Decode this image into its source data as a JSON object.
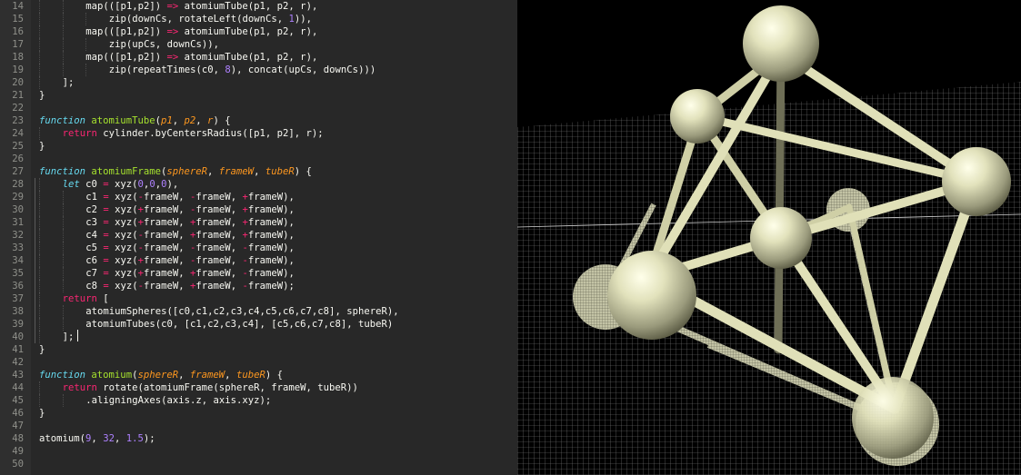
{
  "editor": {
    "lines": [
      {
        "n": "14",
        "ind": 2,
        "t": [
          [
            "map(([p1,p2]) ",
            ""
          ],
          [
            "=>",
            "op"
          ],
          [
            " atomiumTube(p1, p2, r),",
            ""
          ]
        ]
      },
      {
        "n": "15",
        "ind": 3,
        "t": [
          [
            "zip(downCs, rotateLeft(downCs, ",
            ""
          ],
          [
            "1",
            "num"
          ],
          [
            ")),",
            ""
          ]
        ]
      },
      {
        "n": "16",
        "ind": 2,
        "t": [
          [
            "map(([p1,p2]) ",
            ""
          ],
          [
            "=>",
            "op"
          ],
          [
            " atomiumTube(p1, p2, r),",
            ""
          ]
        ]
      },
      {
        "n": "17",
        "ind": 3,
        "t": [
          [
            "zip(upCs, downCs)),",
            ""
          ]
        ]
      },
      {
        "n": "18",
        "ind": 2,
        "t": [
          [
            "map(([p1,p2]) ",
            ""
          ],
          [
            "=>",
            "op"
          ],
          [
            " atomiumTube(p1, p2, r),",
            ""
          ]
        ]
      },
      {
        "n": "19",
        "ind": 3,
        "t": [
          [
            "zip(repeatTimes(c0, ",
            ""
          ],
          [
            "8",
            "num"
          ],
          [
            "), concat(upCs, downCs)))",
            ""
          ]
        ]
      },
      {
        "n": "20",
        "ind": 1,
        "t": [
          [
            "];",
            ""
          ]
        ]
      },
      {
        "n": "21",
        "ind": 0,
        "t": [
          [
            "}",
            ""
          ]
        ]
      },
      {
        "n": "22",
        "ind": 0,
        "t": []
      },
      {
        "n": "23",
        "ind": 0,
        "t": [
          [
            "function",
            "kw"
          ],
          [
            " ",
            ""
          ],
          [
            "atomiumTube",
            "fn"
          ],
          [
            "(",
            ""
          ],
          [
            "p1",
            "prm"
          ],
          [
            ", ",
            ""
          ],
          [
            "p2",
            "prm"
          ],
          [
            ", ",
            ""
          ],
          [
            "r",
            "prm"
          ],
          [
            ") {",
            ""
          ]
        ]
      },
      {
        "n": "24",
        "ind": 1,
        "t": [
          [
            "return",
            "kw2"
          ],
          [
            " cylinder.byCentersRadius([p1, p2], r);",
            ""
          ]
        ]
      },
      {
        "n": "25",
        "ind": 0,
        "t": [
          [
            "}",
            ""
          ]
        ]
      },
      {
        "n": "26",
        "ind": 0,
        "t": []
      },
      {
        "n": "27",
        "ind": 0,
        "t": [
          [
            "function",
            "kw"
          ],
          [
            " ",
            ""
          ],
          [
            "atomiumFrame",
            "fn"
          ],
          [
            "(",
            ""
          ],
          [
            "sphereR",
            "prm"
          ],
          [
            ", ",
            ""
          ],
          [
            "frameW",
            "prm"
          ],
          [
            ", ",
            ""
          ],
          [
            "tubeR",
            "prm"
          ],
          [
            ") {",
            ""
          ]
        ]
      },
      {
        "n": "28",
        "ind": 1,
        "t": [
          [
            "let",
            "kw"
          ],
          [
            " c0 ",
            ""
          ],
          [
            "=",
            "op"
          ],
          [
            " xyz(",
            ""
          ],
          [
            "0",
            "num"
          ],
          [
            ",",
            ""
          ],
          [
            "0",
            "num"
          ],
          [
            ",",
            ""
          ],
          [
            "0",
            "num"
          ],
          [
            "),",
            ""
          ]
        ]
      },
      {
        "n": "29",
        "ind": 2,
        "t": [
          [
            "c1 ",
            ""
          ],
          [
            "=",
            "op"
          ],
          [
            " xyz(",
            ""
          ],
          [
            "-",
            "op"
          ],
          [
            "frameW, ",
            ""
          ],
          [
            "-",
            "op"
          ],
          [
            "frameW, ",
            ""
          ],
          [
            "+",
            "op"
          ],
          [
            "frameW),",
            ""
          ]
        ]
      },
      {
        "n": "30",
        "ind": 2,
        "t": [
          [
            "c2 ",
            ""
          ],
          [
            "=",
            "op"
          ],
          [
            " xyz(",
            ""
          ],
          [
            "+",
            "op"
          ],
          [
            "frameW, ",
            ""
          ],
          [
            "-",
            "op"
          ],
          [
            "frameW, ",
            ""
          ],
          [
            "+",
            "op"
          ],
          [
            "frameW),",
            ""
          ]
        ]
      },
      {
        "n": "31",
        "ind": 2,
        "t": [
          [
            "c3 ",
            ""
          ],
          [
            "=",
            "op"
          ],
          [
            " xyz(",
            ""
          ],
          [
            "+",
            "op"
          ],
          [
            "frameW, ",
            ""
          ],
          [
            "+",
            "op"
          ],
          [
            "frameW, ",
            ""
          ],
          [
            "+",
            "op"
          ],
          [
            "frameW),",
            ""
          ]
        ]
      },
      {
        "n": "32",
        "ind": 2,
        "t": [
          [
            "c4 ",
            ""
          ],
          [
            "=",
            "op"
          ],
          [
            " xyz(",
            ""
          ],
          [
            "-",
            "op"
          ],
          [
            "frameW, ",
            ""
          ],
          [
            "+",
            "op"
          ],
          [
            "frameW, ",
            ""
          ],
          [
            "+",
            "op"
          ],
          [
            "frameW),",
            ""
          ]
        ]
      },
      {
        "n": "33",
        "ind": 2,
        "t": [
          [
            "c5 ",
            ""
          ],
          [
            "=",
            "op"
          ],
          [
            " xyz(",
            ""
          ],
          [
            "-",
            "op"
          ],
          [
            "frameW, ",
            ""
          ],
          [
            "-",
            "op"
          ],
          [
            "frameW, ",
            ""
          ],
          [
            "-",
            "op"
          ],
          [
            "frameW),",
            ""
          ]
        ]
      },
      {
        "n": "34",
        "ind": 2,
        "t": [
          [
            "c6 ",
            ""
          ],
          [
            "=",
            "op"
          ],
          [
            " xyz(",
            ""
          ],
          [
            "+",
            "op"
          ],
          [
            "frameW, ",
            ""
          ],
          [
            "-",
            "op"
          ],
          [
            "frameW, ",
            ""
          ],
          [
            "-",
            "op"
          ],
          [
            "frameW),",
            ""
          ]
        ]
      },
      {
        "n": "35",
        "ind": 2,
        "t": [
          [
            "c7 ",
            ""
          ],
          [
            "=",
            "op"
          ],
          [
            " xyz(",
            ""
          ],
          [
            "+",
            "op"
          ],
          [
            "frameW, ",
            ""
          ],
          [
            "+",
            "op"
          ],
          [
            "frameW, ",
            ""
          ],
          [
            "-",
            "op"
          ],
          [
            "frameW),",
            ""
          ]
        ]
      },
      {
        "n": "36",
        "ind": 2,
        "t": [
          [
            "c8 ",
            ""
          ],
          [
            "=",
            "op"
          ],
          [
            " xyz(",
            ""
          ],
          [
            "-",
            "op"
          ],
          [
            "frameW, ",
            ""
          ],
          [
            "+",
            "op"
          ],
          [
            "frameW, ",
            ""
          ],
          [
            "-",
            "op"
          ],
          [
            "frameW);",
            ""
          ]
        ]
      },
      {
        "n": "37",
        "ind": 1,
        "t": [
          [
            "return",
            "kw2"
          ],
          [
            " [",
            ""
          ]
        ]
      },
      {
        "n": "38",
        "ind": 2,
        "t": [
          [
            "atomiumSpheres([c0,c1,c2,c3,c4,c5,c6,c7,c8], sphereR),",
            ""
          ]
        ]
      },
      {
        "n": "39",
        "ind": 2,
        "t": [
          [
            "atomiumTubes(c0, [c1,c2,c3,c4], [c5,c6,c7,c8], tubeR)",
            ""
          ]
        ]
      },
      {
        "n": "40",
        "ind": 1,
        "t": [
          [
            "];",
            ""
          ]
        ]
      },
      {
        "n": "41",
        "ind": 0,
        "t": [
          [
            "}",
            ""
          ]
        ]
      },
      {
        "n": "42",
        "ind": 0,
        "t": []
      },
      {
        "n": "43",
        "ind": 0,
        "t": [
          [
            "function",
            "kw"
          ],
          [
            " ",
            ""
          ],
          [
            "atomium",
            "fn"
          ],
          [
            "(",
            ""
          ],
          [
            "sphereR",
            "prm"
          ],
          [
            ", ",
            ""
          ],
          [
            "frameW",
            "prm"
          ],
          [
            ", ",
            ""
          ],
          [
            "tubeR",
            "prm"
          ],
          [
            ") {",
            ""
          ]
        ]
      },
      {
        "n": "44",
        "ind": 1,
        "t": [
          [
            "return",
            "kw2"
          ],
          [
            " rotate(atomiumFrame(sphereR, frameW, tubeR))",
            ""
          ]
        ]
      },
      {
        "n": "45",
        "ind": 2,
        "t": [
          [
            ".aligningAxes(axis.z, axis.xyz);",
            ""
          ]
        ]
      },
      {
        "n": "46",
        "ind": 0,
        "t": [
          [
            "}",
            ""
          ]
        ]
      },
      {
        "n": "47",
        "ind": 0,
        "t": []
      },
      {
        "n": "48",
        "ind": 0,
        "t": [
          [
            "atomium(",
            ""
          ],
          [
            "9",
            "num"
          ],
          [
            ", ",
            ""
          ],
          [
            "32",
            "num"
          ],
          [
            ", ",
            ""
          ],
          [
            "1.5",
            "num"
          ],
          [
            ");",
            ""
          ]
        ]
      },
      {
        "n": "49",
        "ind": 0,
        "t": []
      },
      {
        "n": "50",
        "ind": 0,
        "t": []
      }
    ]
  },
  "colors": {
    "editor_bg": "#282828",
    "gutter_bg": "#2f2f2f",
    "line_number": "#8f908a",
    "plain": "#f8f8f2",
    "keyword_storage": "#66d9ef",
    "keyword_control": "#f92672",
    "function_name": "#a6e22e",
    "parameter": "#fd971f",
    "number": "#ae81ff",
    "operator": "#f92672",
    "model": "#dcdcb4",
    "grid": "#bdbdbd"
  },
  "viewport": {
    "model": "atomium",
    "floor": "grid-plane"
  }
}
